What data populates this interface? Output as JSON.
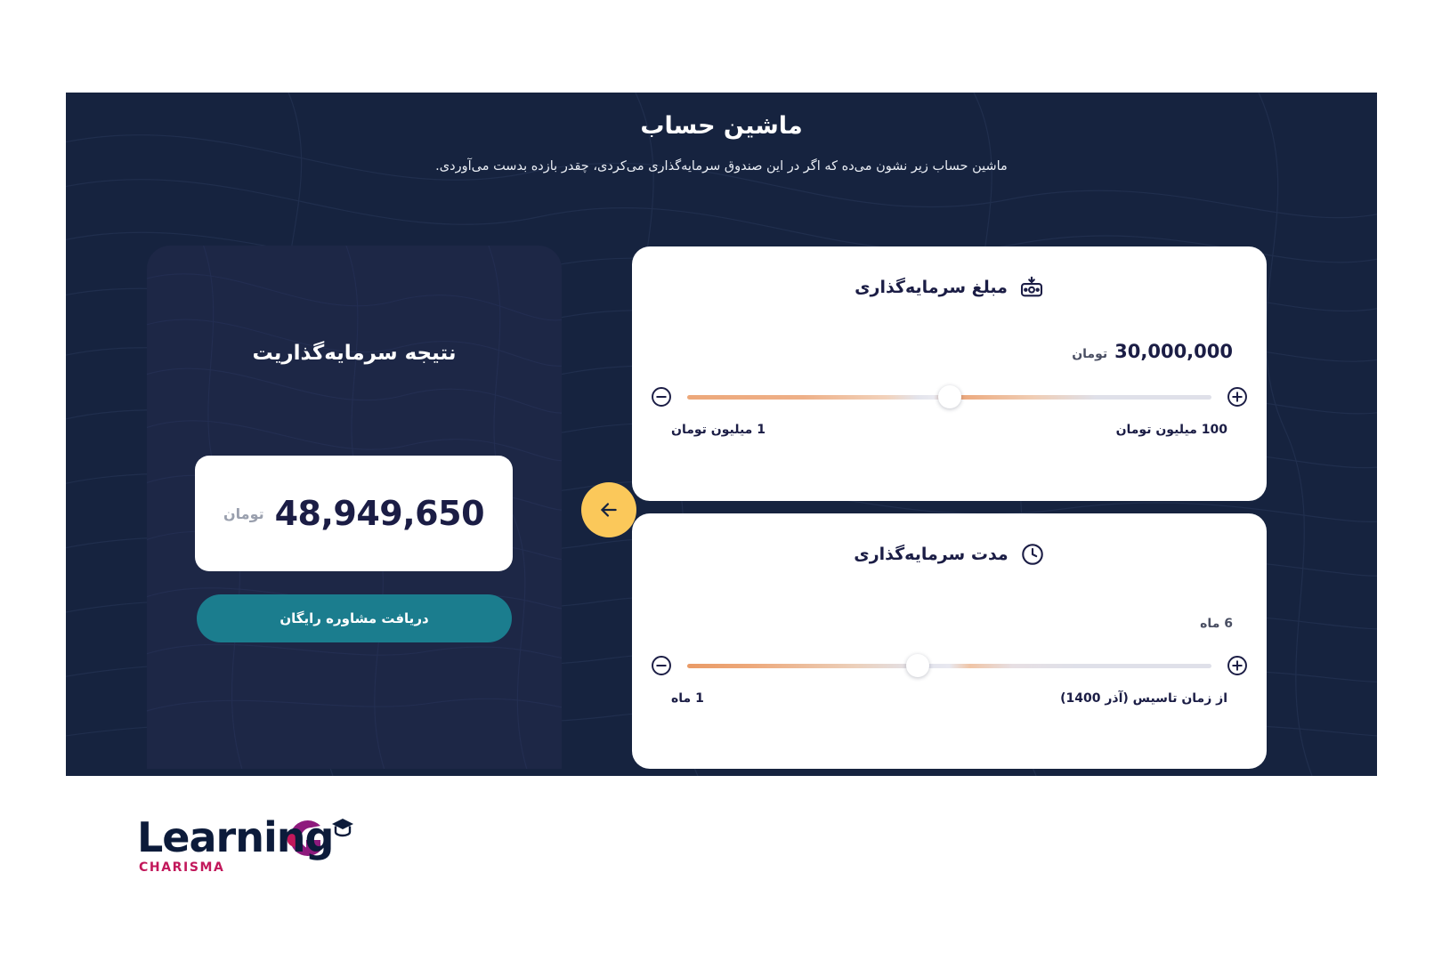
{
  "hero": {
    "title": "ماشین حساب",
    "subtitle": "ماشین حساب زیر نشون می‌ده که اگر در این صندوق سرمایه‌گذاری می‌کردی، چقدر بازده بدست می‌آوردی."
  },
  "result": {
    "title": "نتیجه سرمایه‌گذاریت",
    "amount": "48,949,650",
    "unit": "تومان",
    "cta_label": "دریافت مشاوره رایگان"
  },
  "arrow": {
    "icon": "arrow-left-icon"
  },
  "amount_card": {
    "title": "مبلغ سرمایه‌گذاری",
    "icon": "deposit-box-icon",
    "value": "30,000,000",
    "value_unit": "تومان",
    "min_label": "1 میلیون تومان",
    "max_label": "100 میلیون تومان",
    "decrease_icon": "minus-circle-icon",
    "increase_icon": "plus-circle-icon",
    "slider_percent": 50
  },
  "duration_card": {
    "title": "مدت سرمایه‌گذاری",
    "icon": "clock-icon",
    "value": "6 ماه",
    "min_label": "1 ماه",
    "max_label": "از زمان تاسیس (آذر 1400)",
    "decrease_icon": "minus-circle-icon",
    "increase_icon": "plus-circle-icon",
    "slider_percent": 44
  },
  "logo": {
    "word": "Learning",
    "sub": "CHARISMA",
    "mark": "charisma-c-icon"
  },
  "colors": {
    "hero_bg": "#16233f",
    "panel_bg": "#1d2746",
    "cta": "#1b7d8e",
    "accent_badge": "#fbc85a",
    "slider_accent": "#eda87a",
    "text_dark": "#1b1d45",
    "logo_pink": "#c2185b"
  }
}
